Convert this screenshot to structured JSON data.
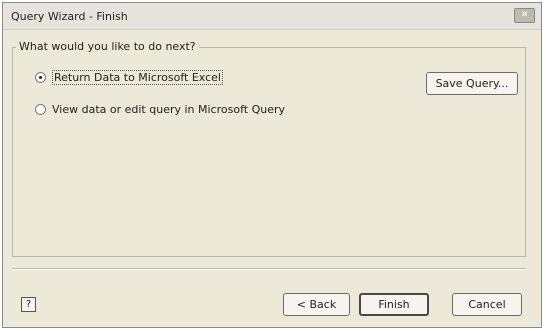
{
  "window": {
    "title": "Query Wizard - Finish",
    "close_glyph": "✕"
  },
  "group": {
    "legend": "What would you like to do next?"
  },
  "options": [
    {
      "label": "Return Data to Microsoft Excel",
      "checked": true
    },
    {
      "label": "View data or edit query in Microsoft Query",
      "checked": false
    }
  ],
  "buttons": {
    "save_query": "Save Query...",
    "back": "< Back",
    "finish": "Finish",
    "cancel": "Cancel",
    "help": "?"
  }
}
